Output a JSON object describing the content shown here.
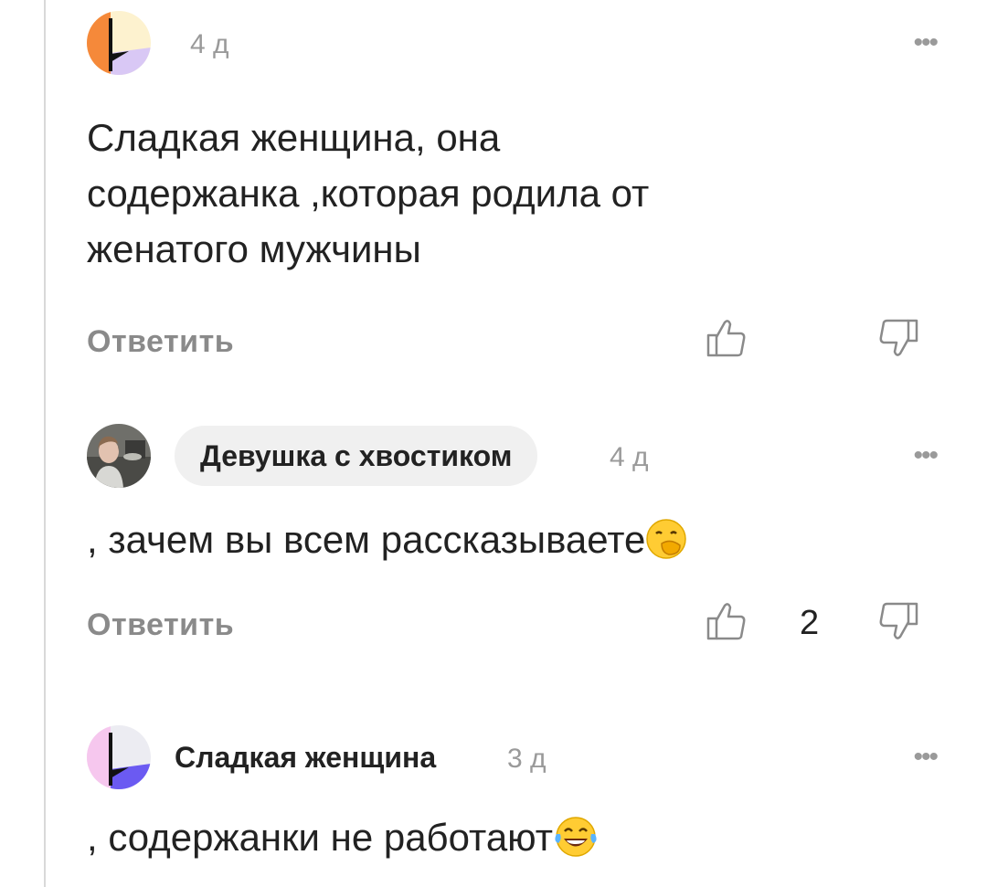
{
  "comments": [
    {
      "author": "",
      "time": "4 д",
      "text_lines": [
        "Сладкая женщина, она",
        "содержанка ,которая родила от",
        "женатого мужчины"
      ],
      "reply_label": "Ответить",
      "likes": "",
      "avatar_colors": {
        "left": "#f5893a",
        "right": "#fdf2cf",
        "bottom": "#d9c8f5"
      }
    },
    {
      "author": "Девушка с хвостиком",
      "time": "4 д",
      "text": ", зачем вы всем рассказываете",
      "emoji": "face-with-hand-over-mouth",
      "reply_label": "Ответить",
      "likes": "2"
    },
    {
      "author": "Сладкая женщина",
      "time": "3 д",
      "text": ", содержанки не работают",
      "emoji": "face-with-tears-of-joy",
      "avatar_colors": {
        "left": "#f6c7ee",
        "right": "#ececf2",
        "bottom": "#6b5af2"
      }
    }
  ],
  "more_icon": "more-dots-icon",
  "colors": {
    "muted": "#9a9a9a",
    "text": "#222222",
    "pill": "#f0f0f0"
  }
}
